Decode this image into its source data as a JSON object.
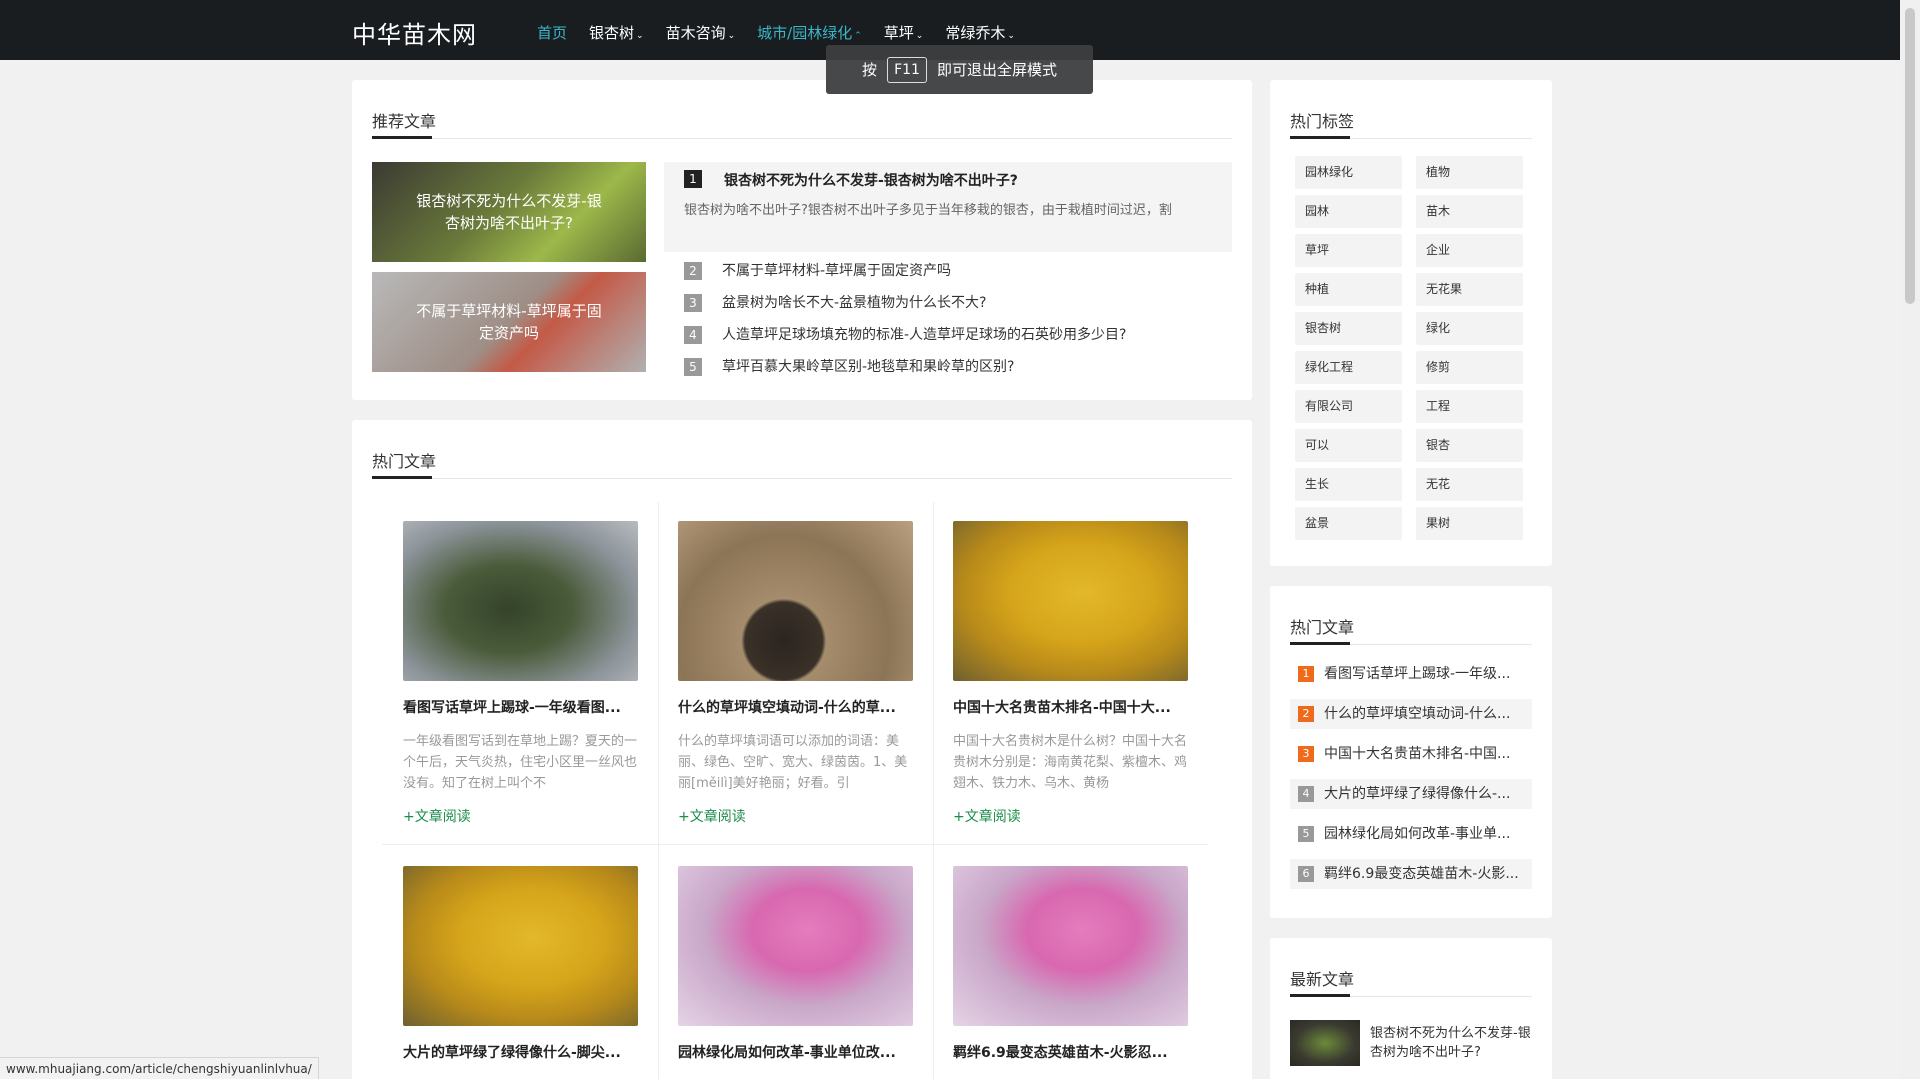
{
  "site": {
    "logo": "中华苗木网",
    "nav": [
      {
        "label": "首页",
        "caret": "",
        "active": true
      },
      {
        "label": "银杏树",
        "caret": "⌄"
      },
      {
        "label": "苗木咨询",
        "caret": "⌄"
      },
      {
        "label": "城市/园林绿化",
        "caret": "⌃",
        "active": true
      },
      {
        "label": "草坪",
        "caret": "⌄"
      },
      {
        "label": "常绿乔木",
        "caret": "⌄"
      }
    ]
  },
  "toast": {
    "pre": "按",
    "key": "F11",
    "post": "即可退出全屏模式"
  },
  "recommended": {
    "title": "推荐文章",
    "images": [
      "银杏树不死为什么不发芽-银杏树为啥不出叶子?",
      "不属于草坪材料-草坪属于固定资产吗"
    ],
    "top": {
      "num": "1",
      "title": "银杏树不死为什么不发芽-银杏树为啥不出叶子?",
      "desc": "银杏树为啥不出叶子?银杏树不出叶子多见于当年移栽的银杏，由于栽植时间过迟，割"
    },
    "rows": [
      {
        "num": "2",
        "title": "不属于草坪材料-草坪属于固定资产吗"
      },
      {
        "num": "3",
        "title": "盆景树为啥长不大-盆景植物为什么长不大?"
      },
      {
        "num": "4",
        "title": "人造草坪足球场填充物的标准-人造草坪足球场的石英砂用多少目?"
      },
      {
        "num": "5",
        "title": "草坪百慕大果岭草区别-地毯草和果岭草的区别?"
      }
    ]
  },
  "hot": {
    "title": "热门文章",
    "posts": [
      {
        "title": "看图写话草坪上踢球-一年级看图...",
        "desc": "一年级看图写话到在草地上踢？夏天的一个午后，天气炎热，住宅小区里一丝风也没有。知了在树上叫个不",
        "more": "+文章阅读"
      },
      {
        "title": "什么的草坪填空填动词-什么的草...",
        "desc": "什么的草坪填词语可以添加的词语：美丽、绿色、空旷、宽大、绿茵茵。1、美丽[měilì]美好艳丽；好看。引",
        "more": "+文章阅读"
      },
      {
        "title": "中国十大名贵苗木排名-中国十大...",
        "desc": "中国十大名贵树木是什么树？中国十大名贵树木分别是：海南黄花梨、紫檀木、鸡翅木、铁力木、乌木、黄杨",
        "more": "+文章阅读"
      },
      {
        "title": "大片的草坪绿了绿得像什么-脚尖...",
        "desc": "",
        "more": ""
      },
      {
        "title": "园林绿化局如何改革-事业单位改...",
        "desc": "",
        "more": ""
      },
      {
        "title": "羁绊6.9最变态英雄苗木-火影忍...",
        "desc": "",
        "more": ""
      }
    ]
  },
  "tags": {
    "title": "热门标签",
    "items": [
      "园林绿化",
      "植物",
      "园林",
      "苗木",
      "草坪",
      "企业",
      "种植",
      "无花果",
      "银杏树",
      "绿化",
      "绿化工程",
      "修剪",
      "有限公司",
      "工程",
      "可以",
      "银杏",
      "生长",
      "无花",
      "盆景",
      "果树"
    ]
  },
  "side_hot": {
    "title": "热门文章",
    "items": [
      {
        "num": "1",
        "title": "看图写话草坪上踢球-一年级..."
      },
      {
        "num": "2",
        "title": "什么的草坪填空填动词-什么..."
      },
      {
        "num": "3",
        "title": "中国十大名贵苗木排名-中国..."
      },
      {
        "num": "4",
        "title": "大片的草坪绿了绿得像什么-..."
      },
      {
        "num": "5",
        "title": "园林绿化局如何改革-事业单..."
      },
      {
        "num": "6",
        "title": "羁绊6.9最变态英雄苗木-火影..."
      }
    ]
  },
  "side_new": {
    "title": "最新文章",
    "item": "银杏树不死为什么不发芽-银杏树为啥不出叶子?"
  },
  "status_url": "www.mhuajiang.com/article/chengshiyuanlinlvhua/",
  "colors": {
    "accent": "#3bb6c8",
    "topbar": "#1a1d1f",
    "read_more": "#1b8c4a",
    "rank_hot": "#f06a1c"
  }
}
